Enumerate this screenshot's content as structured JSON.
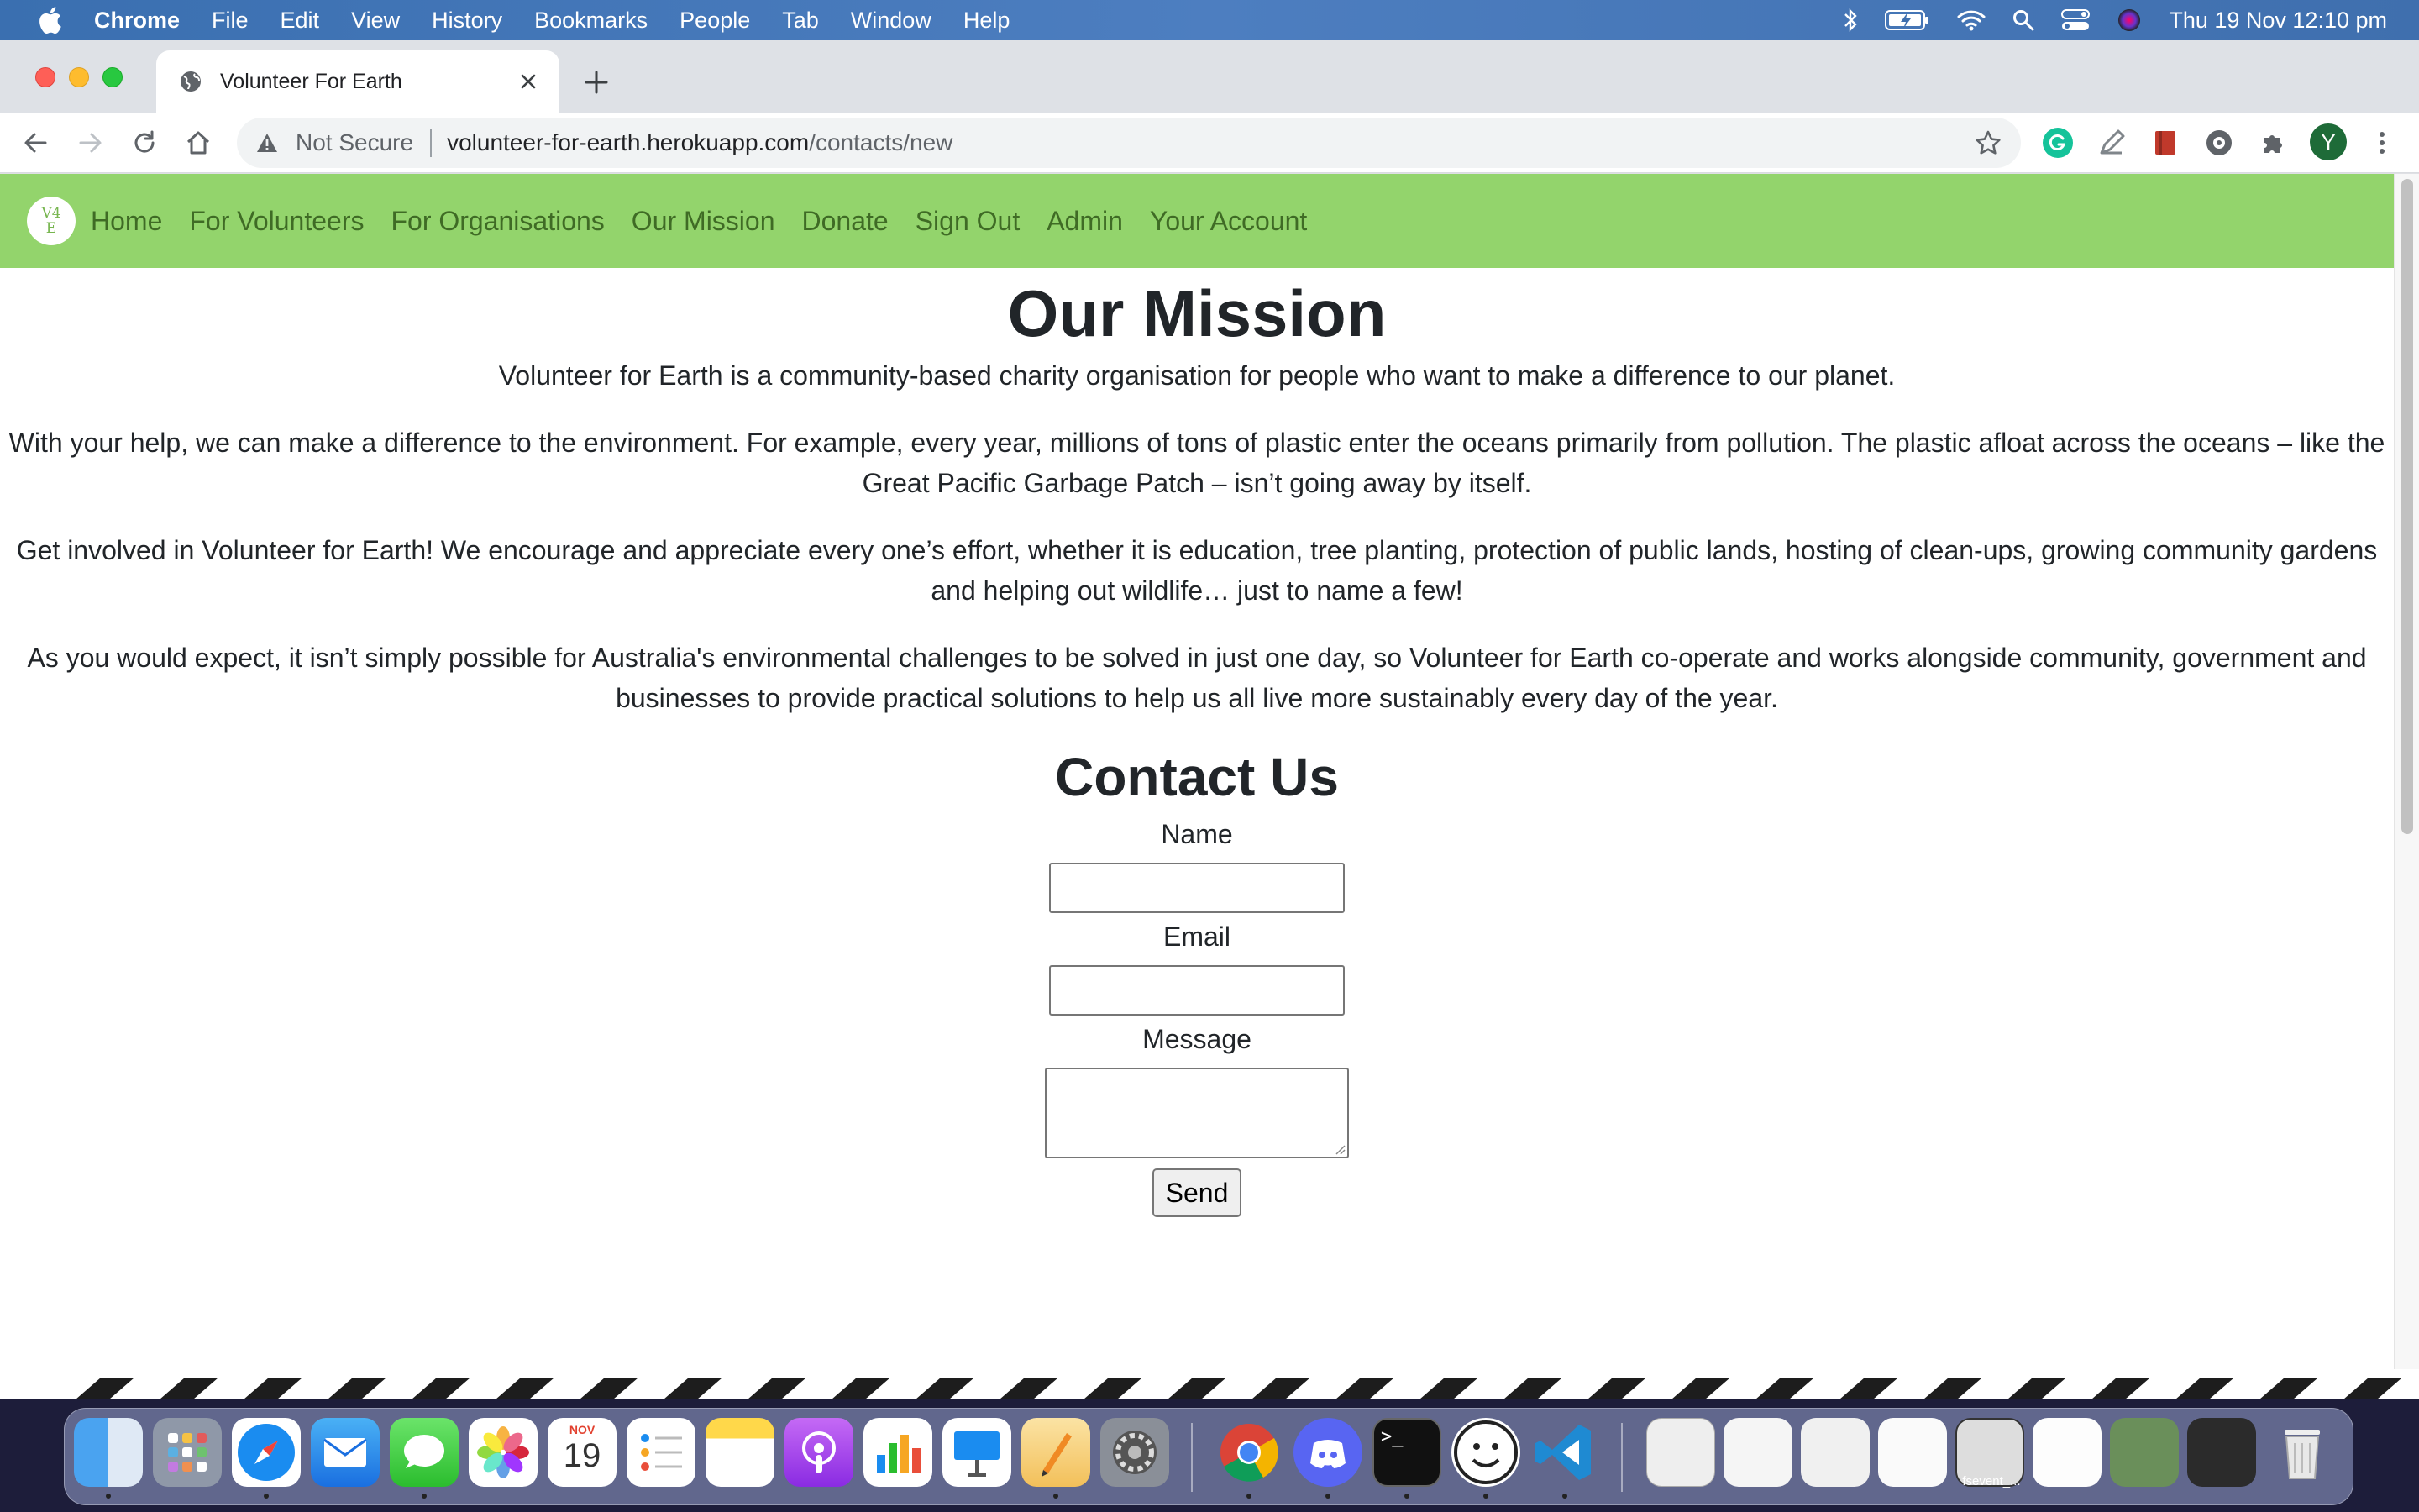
{
  "menubar": {
    "app": "Chrome",
    "items": [
      "File",
      "Edit",
      "View",
      "History",
      "Bookmarks",
      "People",
      "Tab",
      "Window",
      "Help"
    ],
    "clock": "Thu 19 Nov  12:10 pm"
  },
  "browser": {
    "tab_title": "Volunteer For Earth",
    "security_label": "Not Secure",
    "url_host": "volunteer-for-earth.herokuapp.com",
    "url_path": "/contacts/new",
    "profile_initial": "Y"
  },
  "site": {
    "logo_line1": "V4",
    "logo_line2": "E",
    "nav": [
      "Home",
      "For Volunteers",
      "For Organisations",
      "Our Mission",
      "Donate",
      "Sign Out",
      "Admin",
      "Your Account"
    ],
    "brand_color": "#93d46c"
  },
  "mission": {
    "heading": "Our Mission",
    "paragraphs": [
      "Volunteer for Earth is a community-based charity organisation for people who want to make a difference to our planet.",
      "With your help, we can make a difference to the environment. For example, every year, millions of tons of plastic enter the oceans primarily from pollution. The plastic afloat across the oceans – like the Great Pacific Garbage Patch – isn’t going away by itself.",
      "Get involved in Volunteer for Earth! We encourage and appreciate every one’s effort, whether it is education, tree planting, protection of public lands, hosting of clean-ups, growing community gardens and helping out wildlife… just to name a few!",
      "As you would expect, it isn’t simply possible for Australia's environmental challenges to be solved in just one day, so Volunteer for Earth co-operate and works alongside community, government and businesses to provide practical solutions to help us all live more sustainably every day of the year."
    ]
  },
  "contact": {
    "heading": "Contact Us",
    "name_label": "Name",
    "name_value": "",
    "email_label": "Email",
    "email_value": "",
    "message_label": "Message",
    "message_value": "",
    "send_label": "Send"
  },
  "dock": {
    "calendar_month": "NOV",
    "calendar_day": "19",
    "terminal_prompt": ">_",
    "thumbnail_label": "fsevent_..."
  }
}
